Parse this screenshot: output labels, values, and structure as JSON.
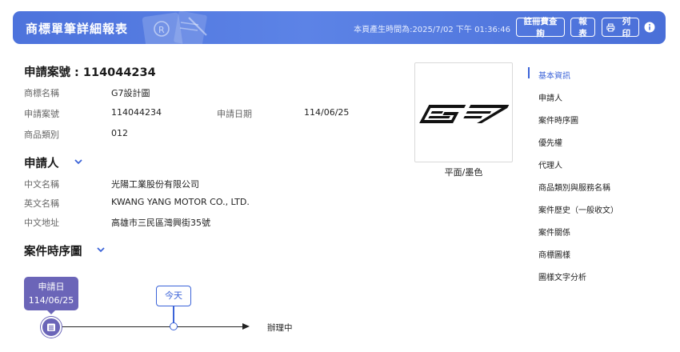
{
  "header": {
    "title": "商標單筆詳細報表",
    "generated_time": "本頁產生時間為:2025/7/02 下午 01:36:46",
    "fee_query_label": "註冊費查詢",
    "report_label": "報表",
    "print_label": "列印",
    "gradient_color": "#5c83e6"
  },
  "basic": {
    "application_heading": "申請案號 : 114044234",
    "rows": [
      {
        "label": "商標名稱",
        "value": "G7設計圖"
      },
      {
        "label": "申請案號",
        "value": "114044234",
        "label2": "申請日期",
        "value2": "114/06/25"
      },
      {
        "label": "商品類別",
        "value": "012"
      }
    ]
  },
  "applicant": {
    "title": "申請人",
    "rows": [
      {
        "label": "中文名稱",
        "value": "光陽工業股份有限公司"
      },
      {
        "label": "英文名稱",
        "value": "KWANG YANG MOTOR CO., LTD."
      },
      {
        "label": "中文地址",
        "value": "高雄市三民區灣興街35號"
      }
    ]
  },
  "timeline": {
    "title": "案件時序圖",
    "start_label": "申請日",
    "start_date": "114/06/25",
    "today_label": "今天",
    "end_label": "辦理中",
    "accent": "#6b65b8"
  },
  "mark_image": {
    "caption": "平面/墨色"
  },
  "nav": {
    "items": [
      {
        "label": "基本資訊",
        "active": true
      },
      {
        "label": "申請人"
      },
      {
        "label": "案件時序圖"
      },
      {
        "label": "優先權"
      },
      {
        "label": "代理人"
      },
      {
        "label": "商品類別與服務名稱"
      },
      {
        "label": "案件歷史（一般收文）"
      },
      {
        "label": "案件關係"
      },
      {
        "label": "商標圖樣"
      },
      {
        "label": "圖樣文字分析"
      }
    ],
    "active_color": "#3b63d8"
  }
}
